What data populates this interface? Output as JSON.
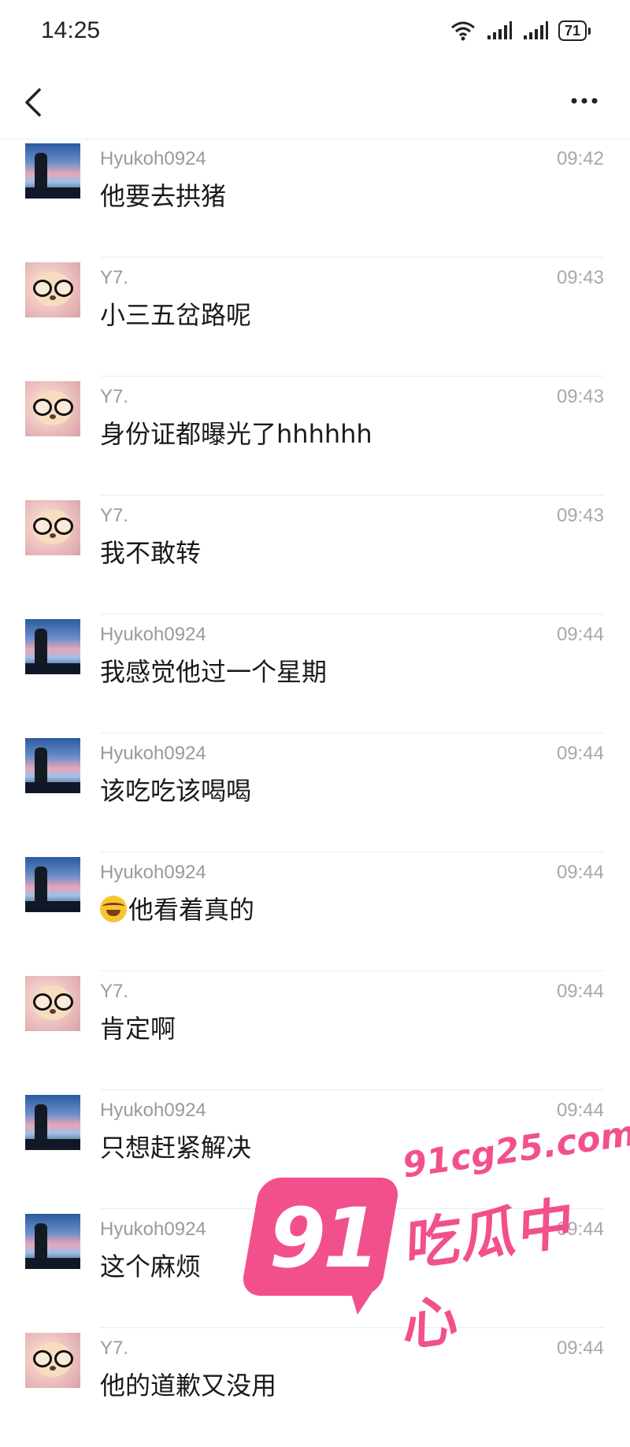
{
  "status_bar": {
    "time": "14:25",
    "battery": "71",
    "icons": [
      "wifi-icon",
      "signal-icon",
      "signal-icon",
      "battery-icon"
    ]
  },
  "top_bar": {
    "back_icon": "chevron-left-icon",
    "more_icon": "more-dots-icon"
  },
  "messages": [
    {
      "sender": "Hyukoh0924",
      "time": "09:42",
      "text": "他要去拱猪",
      "avatar": "hyukoh"
    },
    {
      "sender": "Y7.",
      "time": "09:43",
      "text": "小三五岔路呢",
      "avatar": "y7"
    },
    {
      "sender": "Y7.",
      "time": "09:43",
      "text": "身份证都曝光了hhhhhh",
      "avatar": "y7"
    },
    {
      "sender": "Y7.",
      "time": "09:43",
      "text": "我不敢转",
      "avatar": "y7"
    },
    {
      "sender": "Hyukoh0924",
      "time": "09:44",
      "text": "我感觉他过一个星期",
      "avatar": "hyukoh"
    },
    {
      "sender": "Hyukoh0924",
      "time": "09:44",
      "text": "该吃吃该喝喝",
      "avatar": "hyukoh"
    },
    {
      "sender": "Hyukoh0924",
      "time": "09:44",
      "text": "他看着真的",
      "avatar": "hyukoh",
      "emoji": "laughing-tears-emoji"
    },
    {
      "sender": "Y7.",
      "time": "09:44",
      "text": "肯定啊",
      "avatar": "y7"
    },
    {
      "sender": "Hyukoh0924",
      "time": "09:44",
      "text": "只想赶紧解决",
      "avatar": "hyukoh"
    },
    {
      "sender": "Hyukoh0924",
      "time": "09:44",
      "text": "这个麻烦",
      "avatar": "hyukoh"
    },
    {
      "sender": "Y7.",
      "time": "09:44",
      "text": "他的道歉又没用",
      "avatar": "y7"
    }
  ],
  "watermark": {
    "number": "91",
    "url": "91cg25.com",
    "text": "吃瓜中心",
    "color": "#f2508c"
  }
}
